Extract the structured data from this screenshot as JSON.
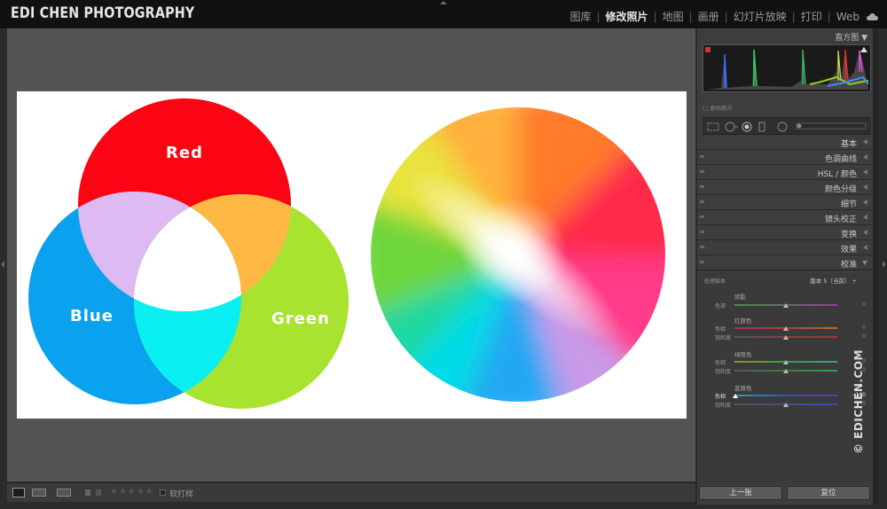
{
  "brand": "EDI CHEN PHOTOGRAPHY",
  "modules": [
    {
      "label": "图库",
      "active": false
    },
    {
      "label": "修改照片",
      "active": true
    },
    {
      "label": "地图",
      "active": false
    },
    {
      "label": "画册",
      "active": false
    },
    {
      "label": "幻灯片放映",
      "active": false
    },
    {
      "label": "打印",
      "active": false
    },
    {
      "label": "Web",
      "active": false
    }
  ],
  "photo": {
    "venn_labels": {
      "red": "Red",
      "blue": "Blue",
      "green": "Green"
    }
  },
  "toolbar": {
    "stars": "★★★★★",
    "softproof_label": "软打样"
  },
  "right_panel": {
    "histogram_title": "直方图",
    "original_label": "原始照片",
    "panels": [
      {
        "label": "基本"
      },
      {
        "label": "色调曲线"
      },
      {
        "label": "HSL / 颜色"
      },
      {
        "label": "颜色分级"
      },
      {
        "label": "细节"
      },
      {
        "label": "镜头校正"
      },
      {
        "label": "变换"
      },
      {
        "label": "效果"
      },
      {
        "label": "校准"
      }
    ],
    "calibration": {
      "process_label": "处理版本",
      "process_value": "版本 5（当前）",
      "shadows_title": "阴影",
      "tint_label": "色调",
      "tint_value": "0",
      "red_title": "红原色",
      "red_hue_label": "色相",
      "red_hue_value": "0",
      "red_sat_label": "饱和度",
      "red_sat_value": "0",
      "green_title": "绿原色",
      "green_hue_label": "色相",
      "green_hue_value": "0",
      "green_sat_label": "饱和度",
      "green_sat_value": "0",
      "blue_title": "蓝原色",
      "blue_hue_label": "色相",
      "blue_hue_value": "- 100",
      "blue_sat_label": "饱和度",
      "blue_sat_value": "0"
    },
    "prev_button": "上一张",
    "reset_button": "复位"
  },
  "watermark": "© EDICHEN.COM"
}
